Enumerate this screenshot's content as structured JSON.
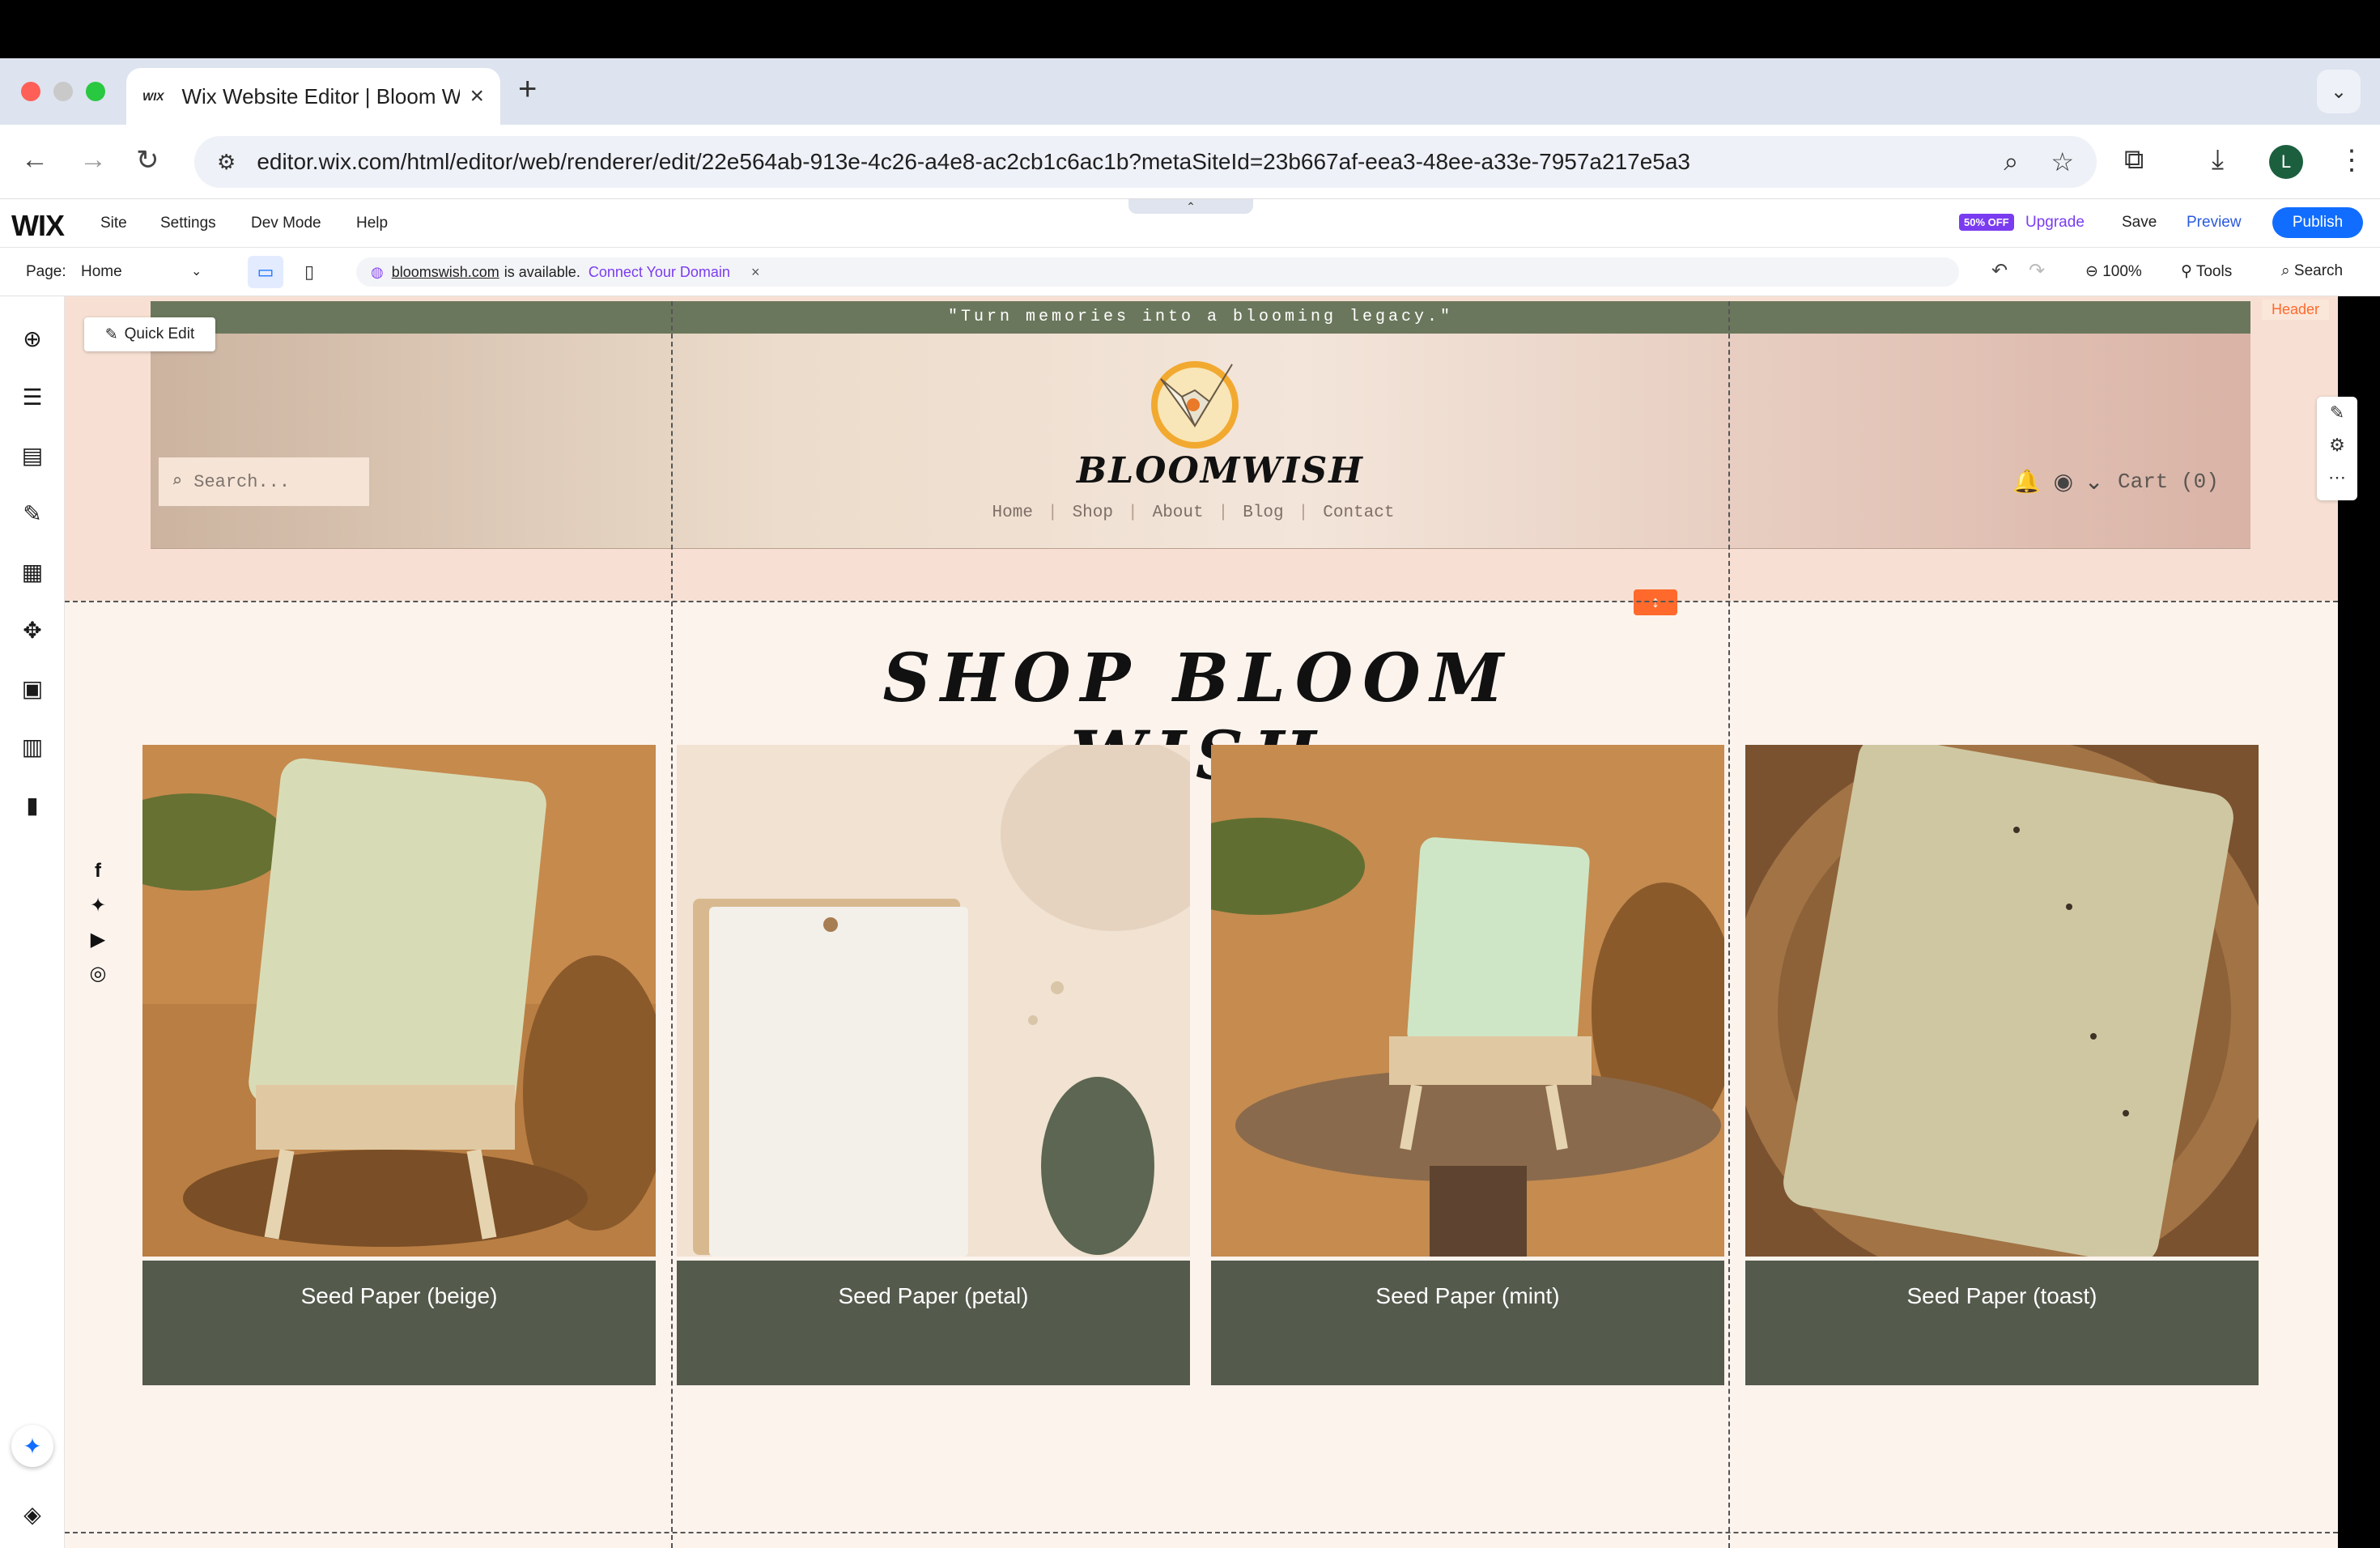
{
  "browser": {
    "tab_title": "Wix Website Editor | Bloom W",
    "tab_favicon": "WIX",
    "url": "editor.wix.com/html/editor/web/renderer/edit/22e564ab-913e-4c26-a4e8-ac2cb1c6ac1b?metaSiteId=23b667af-eea3-48ee-a33e-7957a217e5a3",
    "profile_initial": "L"
  },
  "editor": {
    "logo": "WIX",
    "menu": [
      "Site",
      "Settings",
      "Dev Mode",
      "Help"
    ],
    "discount_badge": "50% OFF",
    "upgrade": "Upgrade",
    "save": "Save",
    "preview": "Preview",
    "publish": "Publish",
    "page_label": "Page:",
    "page_value": "Home",
    "domain": "bloomswish.com",
    "domain_status": "is available.",
    "connect_domain": "Connect Your Domain",
    "zoom": "100%",
    "tools": "Tools",
    "search": "Search",
    "quick_edit": "Quick Edit",
    "header_tag": "Header"
  },
  "site": {
    "tagline": "\"Turn memories into a blooming legacy.\"",
    "search_placeholder": "Search...",
    "brand": "BLOOMWISH",
    "nav": [
      "Home",
      "Shop",
      "About",
      "Blog",
      "Contact"
    ],
    "cart": "Cart (0)",
    "shop_title": "SHOP BLOOM WISH",
    "products": [
      {
        "name": "Seed Paper (beige)",
        "card": "#d8dcb6"
      },
      {
        "name": "Seed Paper (petal)",
        "card": "#f3f0ea"
      },
      {
        "name": "Seed Paper (mint)",
        "card": "#cfe6c6"
      },
      {
        "name": "Seed Paper (toast)",
        "card": "#cfc7a2"
      }
    ]
  },
  "colors": {
    "accent": "#116dff",
    "upgrade": "#7a3cf0",
    "header_strip": "#6b775c",
    "caption_bg": "#545a4c",
    "editor_orange": "#ff6a2c"
  }
}
